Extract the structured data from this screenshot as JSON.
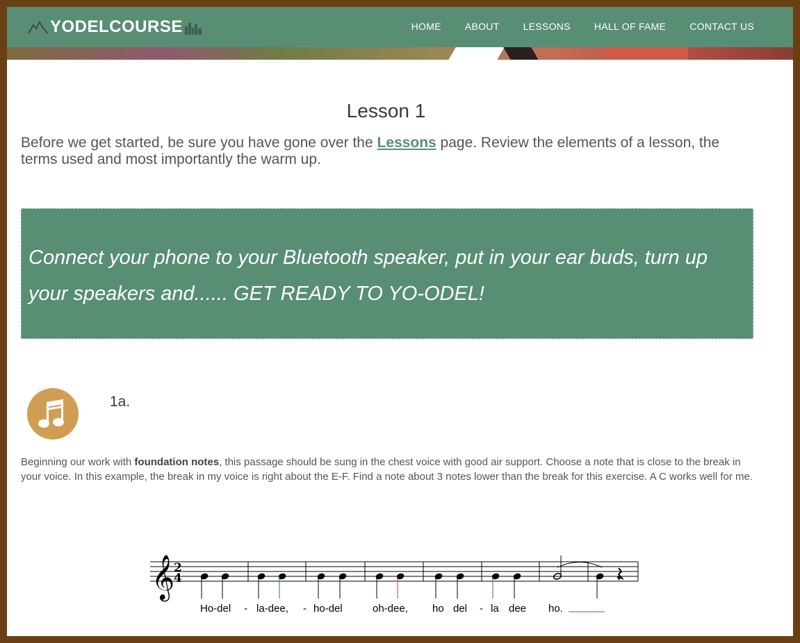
{
  "header": {
    "logo_text": "YODELCOURSE",
    "nav": [
      "HOME",
      "ABOUT",
      "LESSONS",
      "HALL OF FAME",
      "CONTACT US"
    ]
  },
  "main": {
    "title": "Lesson 1",
    "intro_before": "Before we get started, be sure you have gone over the ",
    "intro_link": "Lessons",
    "intro_after": " page. Review the elements of a lesson, the terms used and most importantly the warm up.",
    "callout": "Connect your phone to your Bluetooth speaker, put in your ear buds, turn up your speakers and...... GET READY TO YO-ODEL!",
    "section_label": "1a.",
    "desc_before": "Beginning our work with ",
    "desc_bold": "foundation notes",
    "desc_after": ", this passage should be sung in the chest voice with good air support. Choose a note that is close to the break in your voice. In this example, the break in my voice  is right about the E-F. Find a note about 3 notes lower than the break for this exercise.  A C works well for me."
  },
  "score": {
    "time_signature_top": "2",
    "time_signature_bottom": "4",
    "lyrics": [
      "Ho-del",
      "-",
      "la-dee,",
      "-",
      "ho-del",
      "oh-dee,",
      "ho",
      "del",
      "-",
      "la",
      "dee",
      "ho."
    ]
  },
  "colors": {
    "nav_bg": "#578e74",
    "accent": "#578e74",
    "icon_bg": "#cf9e52",
    "frame": "#6b3f14"
  },
  "icons": [
    "mountain-icon",
    "city-icon",
    "music-notes-icon"
  ]
}
